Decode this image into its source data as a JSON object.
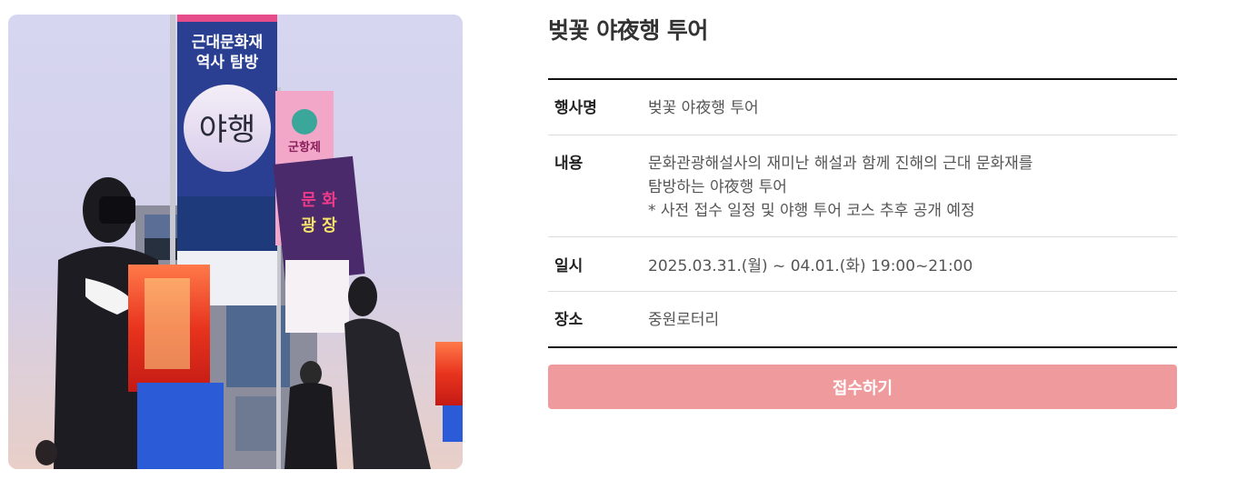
{
  "event": {
    "title": "벚꽃 야夜행 투어",
    "banner_text": "근대문화재\n역사 탐방",
    "banner_script": "야행",
    "festival_text": "군항제"
  },
  "details": {
    "name_label": "행사명",
    "name_value": "벚꽃 야夜행 투어",
    "content_label": "내용",
    "content_lines": [
      "문화관광해설사의 재미난 해설과 함께 진해의 근대 문화재를",
      "탐방하는 야夜행 투어",
      "* 사전 접수 일정 및 야행 투어 코스 추후 공개 예정"
    ],
    "date_label": "일시",
    "date_value": "2025.03.31.(월) ~ 04.01.(화) 19:00~21:00",
    "place_label": "장소",
    "place_value": "중원로터리"
  },
  "apply_button": "접수하기",
  "colors": {
    "button": "#ef9a9c",
    "table_border": "#111111",
    "row_divider": "#dcdcdc"
  }
}
